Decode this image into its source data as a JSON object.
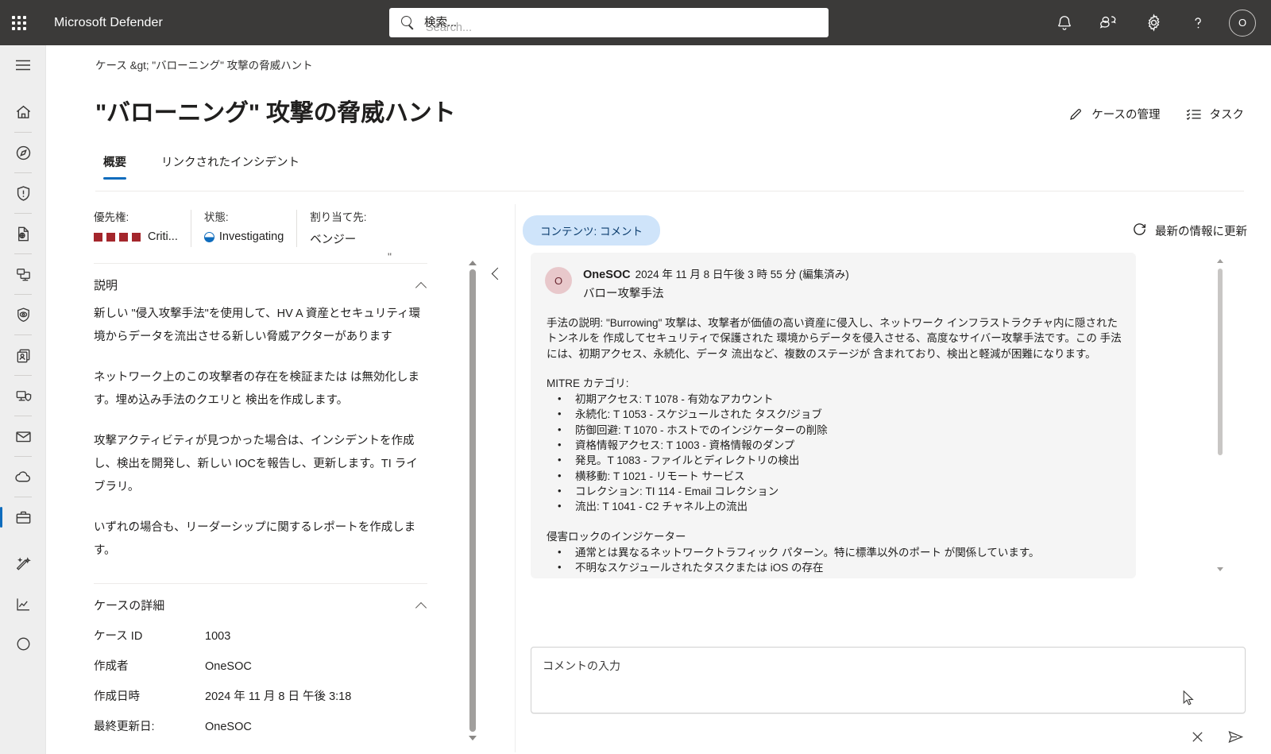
{
  "suitebar": {
    "app_name": "Microsoft Defender",
    "waffle_label": "app-launcher",
    "search": {
      "placeholder_jp": "検索...",
      "placeholder_en": "Search...",
      "value": ""
    },
    "actions": [
      {
        "name": "notifications",
        "label": "通知"
      },
      {
        "name": "feedback",
        "label": "フィードバック"
      },
      {
        "name": "settings",
        "label": "設定"
      },
      {
        "name": "help",
        "label": "ヘルプ"
      }
    ],
    "avatar_initial": "O"
  },
  "rail": {
    "menu_label": "メニュー",
    "items": [
      {
        "name": "home",
        "label": "ホーム"
      },
      {
        "name": "investigation",
        "label": "調査と対応"
      },
      {
        "name": "incidents",
        "label": "インシデントとアラート"
      },
      {
        "name": "hunting",
        "label": "ハンティング"
      },
      {
        "name": "actions",
        "label": "アクションと報告"
      },
      {
        "name": "threat-intelligence",
        "label": "脅威インテリジェンス"
      },
      {
        "name": "assets",
        "label": "資産"
      },
      {
        "name": "endpoints",
        "label": "エンドポイント"
      },
      {
        "name": "email-collaboration",
        "label": "メールとコラボレーション"
      },
      {
        "name": "cloud-apps",
        "label": "クラウド アプリ"
      },
      {
        "name": "cases",
        "label": "ケース"
      },
      {
        "name": "exposure-management",
        "label": "露出管理"
      },
      {
        "name": "reports",
        "label": "レポート"
      }
    ],
    "active": "cases"
  },
  "page": {
    "breadcrumb": "ケース &gt; \"バローニング\" 攻撃の脅威ハント",
    "title": "\"バローニング\" 攻撃の脅威ハント",
    "header_actions": [
      {
        "name": "manage-case",
        "label": "ケースの管理",
        "icon": "pencil-icon"
      },
      {
        "name": "tasks",
        "label": "タスク",
        "icon": "task-list-icon"
      }
    ],
    "tabs": [
      {
        "name": "overview",
        "label": "概要",
        "active": true
      },
      {
        "name": "linked-incidents",
        "label": "リンクされたインシデント",
        "active": false
      }
    ]
  },
  "summary": {
    "priority": {
      "label": "優先権:",
      "value": "Criti...",
      "dots": 4,
      "color": "#a4262c"
    },
    "status": {
      "label": "状態:",
      "value": "Investigating",
      "color": "#0f6cbd"
    },
    "assigned": {
      "label": "割り当て先:",
      "value": "ベンジー"
    }
  },
  "description": {
    "title": "説明",
    "stray_mark": "\"",
    "paragraphs": [
      "新しい \"侵入攻撃手法\"を使用して、HV A 資産とセキュリティ環境からデータを流出させる新しい脅威アクターがあります",
      "ネットワーク上のこの攻撃者の存在を検証または は無効化します。埋め込み手法のクエリと 検出を作成します。",
      "攻撃アクティビティが見つかった場合は、インシデントを作成し、検出を開発し、新しい IOCを報告し、更新します。TI ライブラリ。",
      "いずれの場合も、リーダーシップに関するレポートを作成します。"
    ]
  },
  "case_details": {
    "title": "ケースの詳細",
    "rows": [
      {
        "key": "ケース ID",
        "value": "1003"
      },
      {
        "key": "作成者",
        "value": "OneSOC"
      },
      {
        "key": "作成日時",
        "value": "2024 年 11 月 8 日 午後 3:18"
      },
      {
        "key": "最終更新日:",
        "value": "OneSOC"
      }
    ]
  },
  "comments_panel": {
    "content_pill": "コンテンツ: コメント",
    "refresh_label": "最新の情報に更新",
    "comment": {
      "avatar_initial": "O",
      "author": "OneSOC",
      "timestamp": "2024 年 11 月 8 日午後 3 時 55 分 (編集済み)",
      "subject": "バロー攻撃手法",
      "description": "手法の説明: \"Burrowing\" 攻撃は、攻撃者が価値の高い資産に侵入し、ネットワーク インフラストラクチャ内に隠されたトンネルを 作成してセキュリティで保護された 環境からデータを侵入させる、高度なサイバー攻撃手法です。この 手法には、初期アクセス、永続化、データ 流出など、複数のステージが 含まれており、検出と軽減が困難になります。",
      "mitre_label": "MITRE カテゴリ:",
      "mitre_items": [
        "初期アクセス: T 1078 - 有効なアカウント",
        "永続化: T 1053 - スケジュールされた タスク/ジョブ",
        "防御回避: T 1070 - ホストでのインジケーターの削除",
        "資格情報アクセス: T 1003 - 資格情報のダンプ",
        "発見。T 1083 - ファイルとディレクトリの検出",
        "横移動: T 1021 - リモート サービス",
        "コレクション: TI 114 - Email コレクション",
        "流出: T 1041 - C2 チャネル上の流出"
      ],
      "ioc_label": "侵害ロックのインジケーター",
      "ioc_items": [
        "通常とは異なるネットワークトラフィック パターン。特に標準以外のポート が関係しています。",
        "不明なスケジュールされたタスクまたは iOS の存在"
      ]
    },
    "composer": {
      "placeholder": "コメントの入力",
      "value": ""
    },
    "composer_actions": [
      {
        "name": "discard-comment",
        "label": "破棄",
        "icon": "close-icon"
      },
      {
        "name": "send-comment",
        "label": "送信",
        "icon": "send-icon"
      }
    ]
  }
}
